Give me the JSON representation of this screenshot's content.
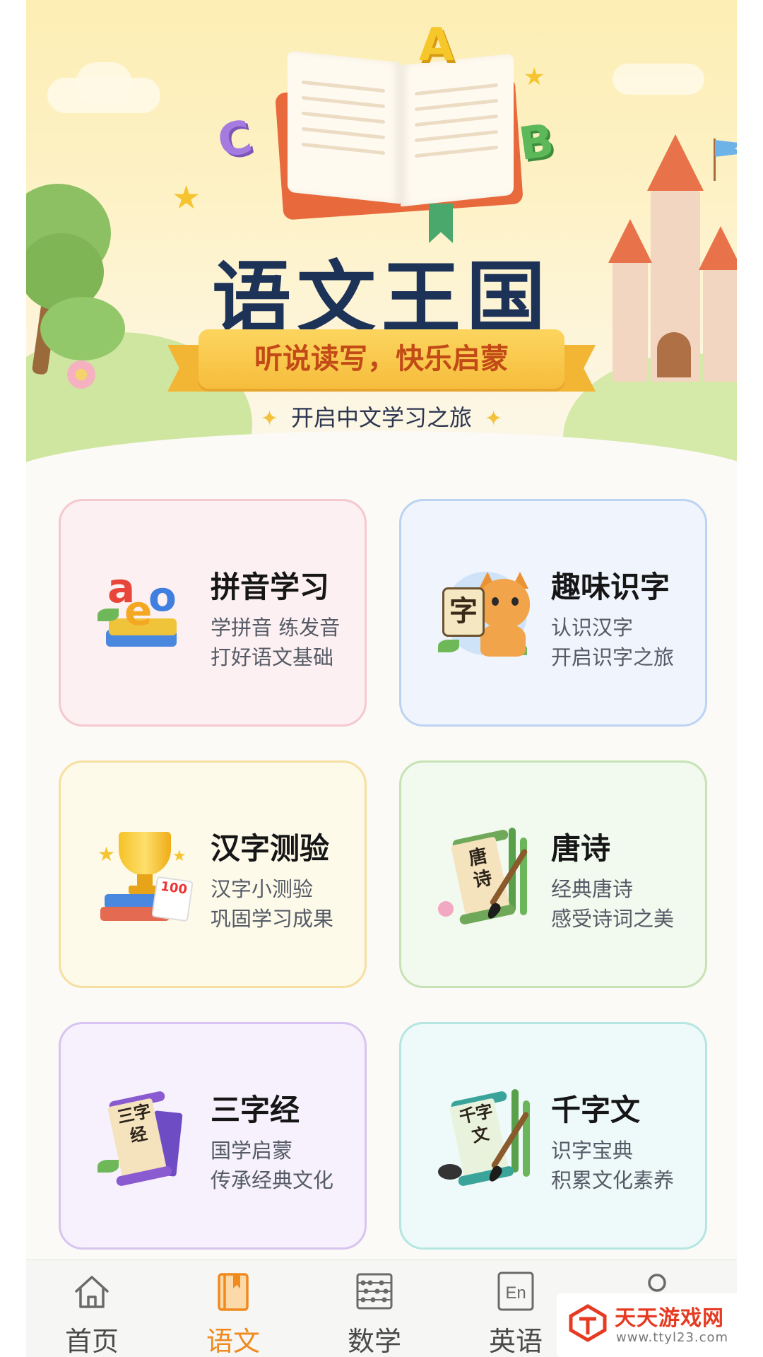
{
  "hero": {
    "letters": [
      "A",
      "B",
      "C"
    ],
    "title": "语文王国",
    "ribbon": "听说读写，快乐启蒙",
    "subtitle": "开启中文学习之旅",
    "sparkle": "✦"
  },
  "cards": [
    {
      "title": "拼音学习",
      "line1": "学拼音 练发音",
      "line2": "打好语文基础",
      "icon_text": [
        "a",
        "e",
        "o"
      ],
      "bg": "#fdf0f2",
      "border": "#f5c8d0"
    },
    {
      "title": "趣味识字",
      "line1": "认识汉字",
      "line2": "开启识字之旅",
      "icon_text": "字",
      "bg": "#eff4fd",
      "border": "#bcd3f2"
    },
    {
      "title": "汉字测验",
      "line1": "汉字小测验",
      "line2": "巩固学习成果",
      "icon_text": "100",
      "bg": "#fdfaea",
      "border": "#f6dfa0"
    },
    {
      "title": "唐诗",
      "line1": "经典唐诗",
      "line2": "感受诗词之美",
      "icon_text": "唐诗",
      "bg": "#f2f9ee",
      "border": "#c6e3b6"
    },
    {
      "title": "三字经",
      "line1": "国学启蒙",
      "line2": "传承经典文化",
      "icon_text": "三字经",
      "bg": "#f6f1fd",
      "border": "#d8c4f0"
    },
    {
      "title": "千字文",
      "line1": "识字宝典",
      "line2": "积累文化素养",
      "icon_text": "千字文",
      "bg": "#eefaf9",
      "border": "#b6e6e2"
    }
  ],
  "tabbar": {
    "tabs": [
      {
        "label": "首页",
        "icon": "home-icon",
        "active": false
      },
      {
        "label": "语文",
        "icon": "book-icon",
        "active": true
      },
      {
        "label": "数学",
        "icon": "abacus-icon",
        "active": false
      },
      {
        "label": "英语",
        "icon": "english-icon",
        "active": false
      },
      {
        "label": "",
        "icon": "profile-icon",
        "active": false
      }
    ],
    "active_color": "#f08a1e"
  },
  "watermark": {
    "name": "天天游戏网",
    "url": "www.ttyl23.com"
  }
}
